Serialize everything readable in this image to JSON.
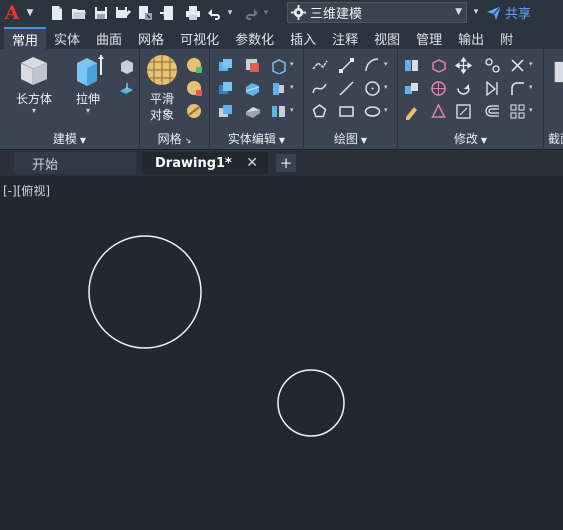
{
  "app": {
    "logo": "A",
    "logo_icon": "autocad-logo-icon"
  },
  "quick_access": {
    "items": [
      "new-icon",
      "open-icon",
      "save-icon",
      "save-as-icon",
      "open-web-icon",
      "save-web-icon",
      "print-icon",
      "undo-icon",
      "redo-icon"
    ],
    "workspace": "三维建模",
    "share_label": "共享"
  },
  "ribbon_tabs": [
    "常用",
    "实体",
    "曲面",
    "网格",
    "可视化",
    "参数化",
    "插入",
    "注释",
    "视图",
    "管理",
    "输出",
    "附"
  ],
  "active_tab": "常用",
  "panels": {
    "modeling": {
      "title": "建模",
      "box_label": "长方体",
      "extrude_label": "拉伸"
    },
    "mesh": {
      "title": "网格",
      "smooth_label_1": "平滑",
      "smooth_label_2": "对象"
    },
    "solid_edit": {
      "title": "实体编辑"
    },
    "draw": {
      "title": "绘图"
    },
    "modify": {
      "title": "修改"
    },
    "section": {
      "title": "截面"
    }
  },
  "doc_tabs": {
    "start": "开始",
    "drawing": "Drawing1*"
  },
  "viewport": {
    "label": "[-][俯视]"
  },
  "colors": {
    "accent": "#4a90e2",
    "canvas": "#212830",
    "ribbon": "#3b4452",
    "logo_red": "#e8342f",
    "share_blue": "#5fa5ff"
  }
}
